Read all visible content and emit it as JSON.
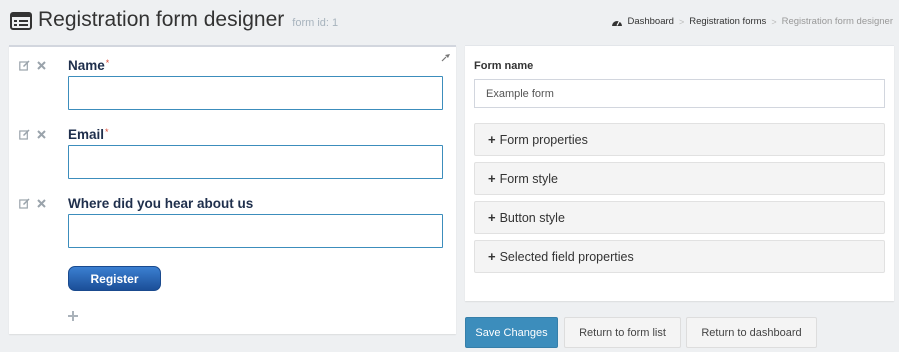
{
  "header": {
    "title": "Registration form designer",
    "form_id": "form id: 1",
    "breadcrumb": {
      "dashboard": "Dashboard",
      "registration_forms": "Registration forms",
      "current": "Registration form designer"
    }
  },
  "form_preview": {
    "fields": [
      {
        "label": "Name",
        "required_mark": "*"
      },
      {
        "label": "Email",
        "required_mark": "*"
      },
      {
        "label": "Where did you hear about us",
        "required_mark": ""
      }
    ],
    "register_label": "Register"
  },
  "settings": {
    "form_name_label": "Form name",
    "form_name_value": "Example form",
    "sections": [
      "Form properties",
      "Form style",
      "Button style",
      "Selected field properties"
    ],
    "section_plus": "+"
  },
  "actions": {
    "save": "Save Changes",
    "return_list": "Return to form list",
    "return_dashboard": "Return to dashboard"
  },
  "icons": {
    "title": "list-window-icon",
    "dashboard": "dashboard-gauge-icon",
    "pin": "pin-icon",
    "edit": "edit-icon",
    "remove": "remove-icon",
    "add": "plus-icon"
  },
  "colors": {
    "primary": "#3c8dbc",
    "register_button": "#1b4f98",
    "label": "#1f2f4c",
    "required": "#dd4b39"
  }
}
